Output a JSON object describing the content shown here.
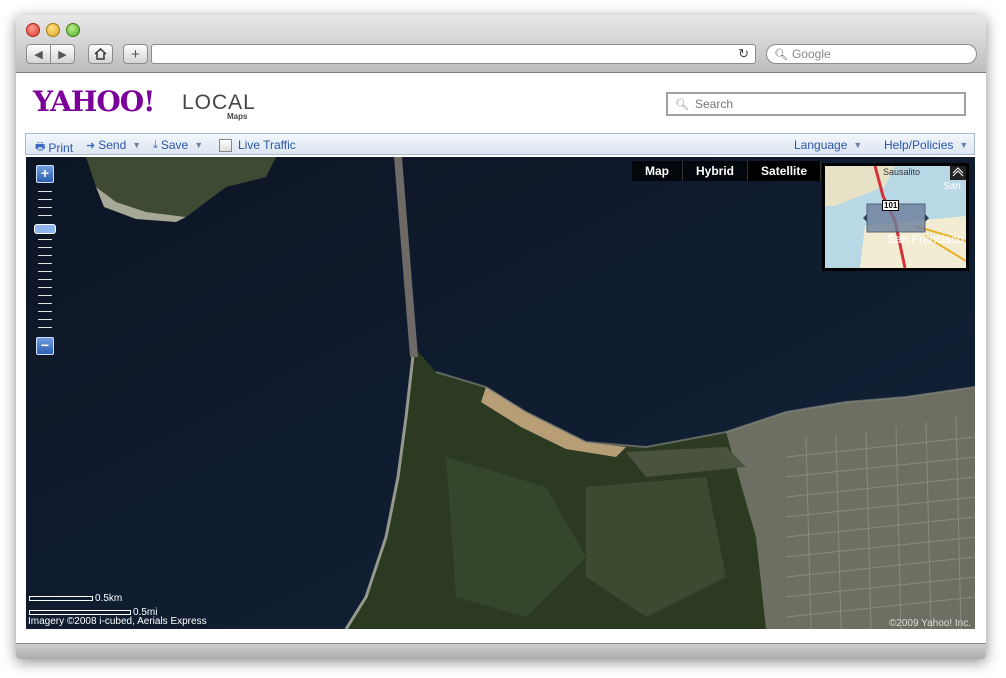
{
  "browser": {
    "search_placeholder": "Google",
    "back_icon": "back-arrow-icon",
    "forward_icon": "forward-arrow-icon",
    "home_icon": "home-icon",
    "add_icon": "plus-icon",
    "reload_icon": "reload-icon",
    "url": ""
  },
  "header": {
    "logo_text": "YAHOO!",
    "logo_local": "LOCAL",
    "logo_maps": "Maps",
    "search_placeholder": "Search"
  },
  "toolbar": {
    "print": "Print",
    "send": "Send",
    "save": "Save",
    "live_traffic": "Live Traffic",
    "language": "Language",
    "help": "Help/Policies"
  },
  "map": {
    "types": [
      "Map",
      "Hybrid",
      "Satellite"
    ],
    "active_type": "Satellite",
    "zoom_plus": "+",
    "zoom_minus": "−",
    "scale_km": "0.5km",
    "scale_mi": "0.5mi",
    "imagery_credit": "Imagery ©2008 i-cubed, Aerials Express",
    "copyright": "©2009 Yahoo! Inc.",
    "minimap": {
      "label_sausalito": "Sausalito",
      "label_sf": "San Francisco",
      "label_san": "San",
      "route_shield": "101"
    }
  },
  "colors": {
    "yahoo_purple": "#7b0099",
    "link_blue": "#2a56a8",
    "water": "#0f1929"
  }
}
